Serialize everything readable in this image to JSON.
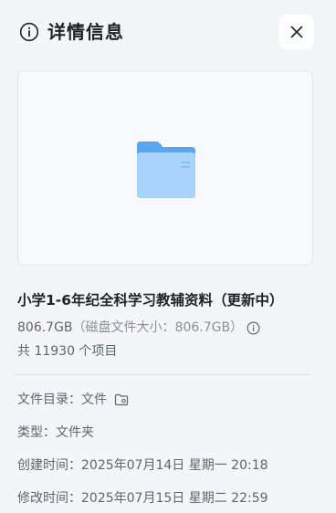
{
  "header": {
    "title": "详情信息",
    "icon": "info-circle-icon",
    "close_icon": "close-icon"
  },
  "preview": {
    "icon": "folder-icon",
    "colors": {
      "folder_back": "#5aa6ef",
      "folder_front": "#a9d3fb"
    }
  },
  "file": {
    "name": "小学1-6年纪全科学习教辅资料（更新中）",
    "size": "806.7GB",
    "disk_size_text": "（磁盘文件大小：806.7GB）",
    "item_count": "共 11930 个项目"
  },
  "meta": {
    "directory_label": "文件目录：",
    "directory_value": "文件",
    "type_label": "类型：",
    "type_value": "文件夹",
    "created_label": "创建时间：",
    "created_value": "2025年07月14日 星期一 20:18",
    "modified_label": "修改时间：",
    "modified_value": "2025年07月15日 星期二 22:59"
  }
}
